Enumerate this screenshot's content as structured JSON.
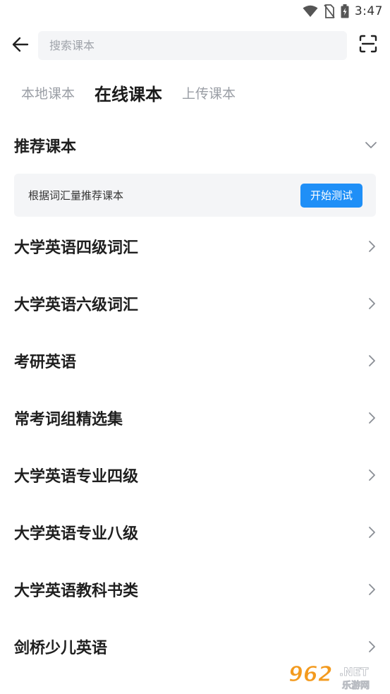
{
  "status_bar": {
    "time": "3:47",
    "icons": [
      "wifi-icon",
      "no-sim-icon",
      "battery-icon"
    ]
  },
  "search": {
    "placeholder": "搜索课本",
    "value": ""
  },
  "header_icons": {
    "back": "arrow-left-icon",
    "scan": "scan-icon"
  },
  "tabs": [
    {
      "label": "本地课本",
      "active": false
    },
    {
      "label": "在线课本",
      "active": true
    },
    {
      "label": "上传课本",
      "active": false
    }
  ],
  "recommend": {
    "title": "推荐课本",
    "expanded": true,
    "card_text": "根据词汇量推荐课本",
    "button_label": "开始测试"
  },
  "books": [
    {
      "title": "大学英语四级词汇"
    },
    {
      "title": "大学英语六级词汇"
    },
    {
      "title": "考研英语"
    },
    {
      "title": "常考词组精选集"
    },
    {
      "title": "大学英语专业四级"
    },
    {
      "title": "大学英语专业八级"
    },
    {
      "title": "大学英语教科书类"
    },
    {
      "title": "剑桥少儿英语"
    }
  ],
  "watermark": {
    "brand": "962",
    "suffix": ".NET",
    "sub": "乐游网"
  },
  "colors": {
    "accent": "#1f8ff7",
    "text_primary": "#1f1f1f",
    "text_muted": "#9a9ea5",
    "surface": "#f4f5f7",
    "watermark_orange": "#f39a1e"
  }
}
